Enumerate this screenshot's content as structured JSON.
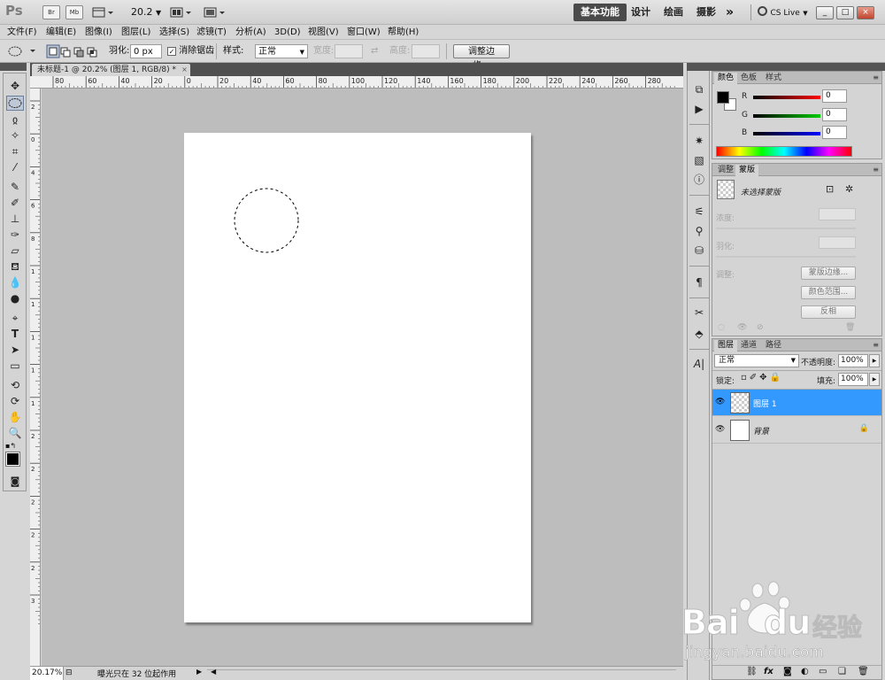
{
  "app": {
    "logo": "Ps",
    "bridge_label": "Br",
    "minibridge_label": "Mb",
    "zoom_value": "20.2",
    "workspaces": [
      "基本功能",
      "设计",
      "绘画",
      "摄影"
    ],
    "more_glyph": "»",
    "cslive": "CS Live",
    "window_buttons": [
      "_",
      "□",
      "×"
    ]
  },
  "menu": [
    "文件(F)",
    "编辑(E)",
    "图像(I)",
    "图层(L)",
    "选择(S)",
    "滤镜(T)",
    "分析(A)",
    "3D(D)",
    "视图(V)",
    "窗口(W)",
    "帮助(H)"
  ],
  "options": {
    "feather_label": "羽化:",
    "feather_value": "0 px",
    "antialias_label": "消除锯齿",
    "style_label": "样式:",
    "style_value": "正常",
    "width_label": "宽度:",
    "height_label": "高度:",
    "refine_button": "调整边缘..."
  },
  "document": {
    "tab_title": "未标题-1 @ 20.2% (图层 1, RGB/8) *",
    "close_glyph": "×",
    "ruler_h_labels": [
      "80",
      "60",
      "40",
      "20",
      "0",
      "20",
      "40",
      "60",
      "80",
      "100",
      "120",
      "140",
      "160",
      "180",
      "200",
      "220",
      "240",
      "260",
      "280"
    ],
    "ruler_v_labels": [
      "2",
      "0",
      "4",
      "6",
      "8",
      "1",
      "1",
      "1",
      "1",
      "1",
      "2",
      "2",
      "2",
      "2",
      "2",
      "3"
    ],
    "selection_shape": "ellipse"
  },
  "status": {
    "zoom": "20.17%",
    "info": "曝光只在 32 位起作用"
  },
  "color_panel": {
    "tabs": [
      "颜色",
      "色板",
      "样式"
    ],
    "channels": [
      {
        "label": "R",
        "value": "0",
        "color": "#cc0000"
      },
      {
        "label": "G",
        "value": "0",
        "color": "#1a9a1a"
      },
      {
        "label": "B",
        "value": "0",
        "color": "#1010cc"
      }
    ],
    "foreground": "#000000",
    "background": "#ffffff"
  },
  "masks_panel": {
    "tabs": [
      "调整",
      "蒙版"
    ],
    "no_mask": "未选择蒙版",
    "density_label": "浓度:",
    "feather_label": "羽化:",
    "refine_label": "调整:",
    "mask_edge_button": "蒙版边缘...",
    "color_range_button": "颜色范围...",
    "invert_button": "反相"
  },
  "layers_panel": {
    "tabs": [
      "图层",
      "通道",
      "路径"
    ],
    "blend_mode": "正常",
    "opacity_label": "不透明度:",
    "opacity_value": "100%",
    "lock_label": "锁定:",
    "fill_label": "填充:",
    "fill_value": "100%",
    "layers": [
      {
        "name": "图层 1",
        "selected": true
      },
      {
        "name": "背景",
        "selected": false
      }
    ],
    "footer_icons": [
      "link-icon",
      "fx-icon",
      "mask-icon",
      "adjustment-icon",
      "group-icon",
      "new-layer-icon",
      "trash-icon"
    ]
  },
  "watermark": {
    "brand": "Bai",
    "brand2": "du",
    "site_cn": "经验",
    "url": "jingyan.baidu.com"
  }
}
